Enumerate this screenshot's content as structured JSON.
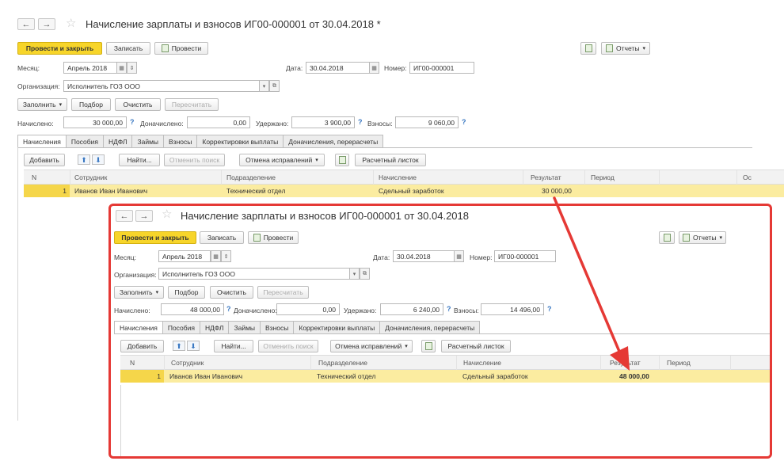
{
  "doc1": {
    "title": "Начисление зарплаты и взносов ИГ00-000001 от 30.04.2018 *",
    "toolbar": {
      "post_close": "Провести и закрыть",
      "save": "Записать",
      "post": "Провести",
      "reports": "Отчеты"
    },
    "month_label": "Месяц:",
    "month_value": "Апрель 2018",
    "date_label": "Дата:",
    "date_value": "30.04.2018",
    "number_label": "Номер:",
    "number_value": "ИГ00-000001",
    "org_label": "Организация:",
    "org_value": "Исполнитель ГОЗ ООО",
    "actions": {
      "fill": "Заполнить",
      "select": "Подбор",
      "clear": "Очистить",
      "recalc": "Пересчитать"
    },
    "totals": {
      "accrued_label": "Начислено:",
      "accrued": "30 000,00",
      "extra_label": "Доначислено:",
      "extra": "0,00",
      "withheld_label": "Удержано:",
      "withheld": "3 900,00",
      "contrib_label": "Взносы:",
      "contrib": "9 060,00",
      "q": "?"
    },
    "tabs": [
      "Начисления",
      "Пособия",
      "НДФЛ",
      "Займы",
      "Взносы",
      "Корректировки выплаты",
      "Доначисления, перерасчеты"
    ],
    "grid_toolbar": {
      "add": "Добавить",
      "up": "⬆",
      "down": "⬇",
      "find": "Найти...",
      "cancel_search": "Отменить поиск",
      "cancel_fix": "Отмена исправлений",
      "payslip": "Расчетный листок"
    },
    "columns": [
      "N",
      "Сотрудник",
      "Подразделение",
      "Начисление",
      "Результат",
      "Период",
      "Ос"
    ],
    "row": {
      "n": "1",
      "employee": "Иванов Иван Иванович",
      "dept": "Технический отдел",
      "accrual": "Сдельный заработок",
      "result": "30 000,00"
    }
  },
  "doc2": {
    "title": "Начисление зарплаты и взносов ИГ00-000001 от 30.04.2018",
    "toolbar": {
      "post_close": "Провести и закрыть",
      "save": "Записать",
      "post": "Провести",
      "reports": "Отчеты"
    },
    "month_label": "Месяц:",
    "month_value": "Апрель 2018",
    "date_label": "Дата:",
    "date_value": "30.04.2018",
    "number_label": "Номер:",
    "number_value": "ИГ00-000001",
    "org_label": "Организация:",
    "org_value": "Исполнитель ГОЗ ООО",
    "actions": {
      "fill": "Заполнить",
      "select": "Подбор",
      "clear": "Очистить",
      "recalc": "Пересчитать"
    },
    "totals": {
      "accrued_label": "Начислено:",
      "accrued": "48 000,00",
      "extra_label": "Доначислено:",
      "extra": "0,00",
      "withheld_label": "Удержано:",
      "withheld": "6 240,00",
      "contrib_label": "Взносы:",
      "contrib": "14 496,00",
      "q": "?"
    },
    "tabs": [
      "Начисления",
      "Пособия",
      "НДФЛ",
      "Займы",
      "Взносы",
      "Корректировки выплаты",
      "Доначисления, перерасчеты"
    ],
    "grid_toolbar": {
      "add": "Добавить",
      "up": "⬆",
      "down": "⬇",
      "find": "Найти...",
      "cancel_search": "Отменить поиск",
      "cancel_fix": "Отмена исправлений",
      "payslip": "Расчетный листок"
    },
    "columns": [
      "N",
      "Сотрудник",
      "Подразделение",
      "Начисление",
      "Результат",
      "Период"
    ],
    "row": {
      "n": "1",
      "employee": "Иванов Иван Иванович",
      "dept": "Технический отдел",
      "accrual": "Сдельный заработок",
      "result": "48 000,00"
    }
  },
  "colors": {
    "highlight": "#e53935",
    "primary_button": "#f7d52a",
    "selected_row": "#fbeca0",
    "link_blue": "#3a78c2"
  },
  "glyphs": {
    "back": "←",
    "forward": "→",
    "star": "☆",
    "caret": "▾",
    "calendar": "▦",
    "spin": "⇕",
    "link": "⧉"
  }
}
